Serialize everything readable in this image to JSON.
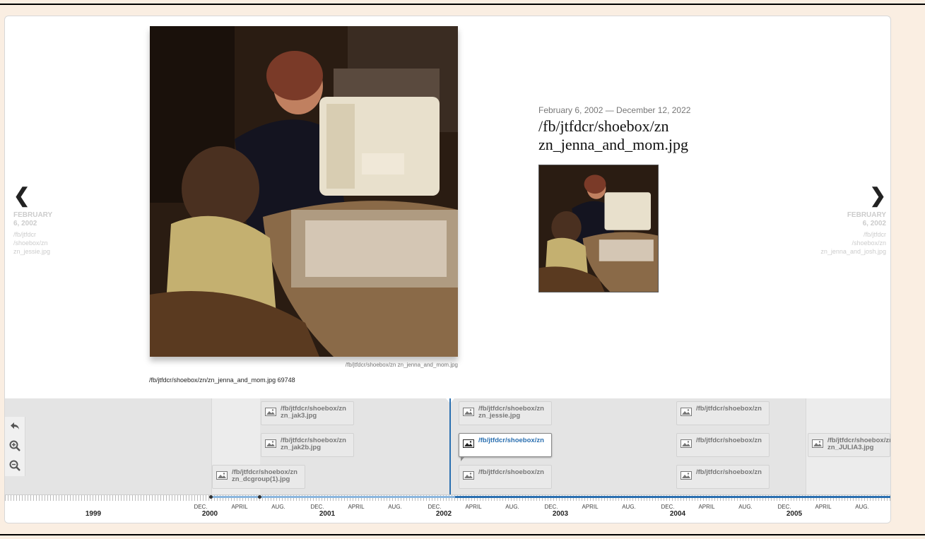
{
  "slide": {
    "date_range": "February 6, 2002 — December 12, 2022",
    "title_line1": "/fb/jtfdcr/shoebox/zn",
    "title_line2": "zn_jenna_and_mom.jpg",
    "media_caption": "/fb/jtfdcr/shoebox/zn zn_jenna_and_mom.jpg",
    "media_credit": "/fb/jtfdcr/shoebox/zn/zn_jenna_and_mom.jpg 69748"
  },
  "nav": {
    "prev": {
      "arrow": "❮",
      "date_line1": "FEBRUARY",
      "date_line2": "6, 2002",
      "title_lines": [
        "/fb/jtfdcr",
        "/shoebox/zn",
        "zn_jessie.jpg"
      ]
    },
    "next": {
      "arrow": "❯",
      "date_line1": "FEBRUARY",
      "date_line2": "6, 2002",
      "title_lines": [
        "/fb/jtfdcr",
        "/shoebox/zn",
        "zn_jenna_and_josh.jpg"
      ]
    }
  },
  "timeline": {
    "markers": [
      {
        "line1": "/fb/jtfdcr/shoebox/zn",
        "line2": "zn_jak3.jpg"
      },
      {
        "line1": "/fb/jtfdcr/shoebox/zn",
        "line2": "zn_jak2b.jpg"
      },
      {
        "line1": "/fb/jtfdcr/shoebox/zn",
        "line2": "zn_dcgroup(1).jpg"
      },
      {
        "line1": "/fb/jtfdcr/shoebox/zn",
        "line2": "zn_jessie.jpg"
      },
      {
        "line1": "/fb/jtfdcr/shoebox/zn",
        "line2": ""
      },
      {
        "line1": "/fb/jtfdcr/shoebox/zn",
        "line2": ""
      },
      {
        "line1": "/fb/jtfdcr/shoebox/zn",
        "line2": ""
      },
      {
        "line1": "/fb/jtfdcr/shoebox/zn",
        "line2": ""
      },
      {
        "line1": "/fb/jtfdcr/shoebox/zn",
        "line2": ""
      },
      {
        "line1": "/fb/jtfdcr/shoebox/zn",
        "line2": "zn_JULIA3.jpg"
      }
    ],
    "axis_months": [
      "DEC.",
      "APRIL",
      "AUG.",
      "DEC.",
      "APRIL",
      "AUG.",
      "DEC.",
      "APRIL",
      "AUG.",
      "DEC.",
      "APRIL",
      "AUG.",
      "DEC.",
      "APRIL",
      "AUG.",
      "DEC.",
      "APRIL",
      "AUG."
    ],
    "axis_years": [
      "1999",
      "2000",
      "2001",
      "2002",
      "2003",
      "2004",
      "2005"
    ]
  },
  "icons": {
    "back": "back-arrow-icon",
    "zoom_in": "zoom-in-icon",
    "zoom_out": "zoom-out-icon",
    "image": "image-icon"
  },
  "colors": {
    "accent": "#2a6fb0",
    "page_background": "#faeee2"
  }
}
